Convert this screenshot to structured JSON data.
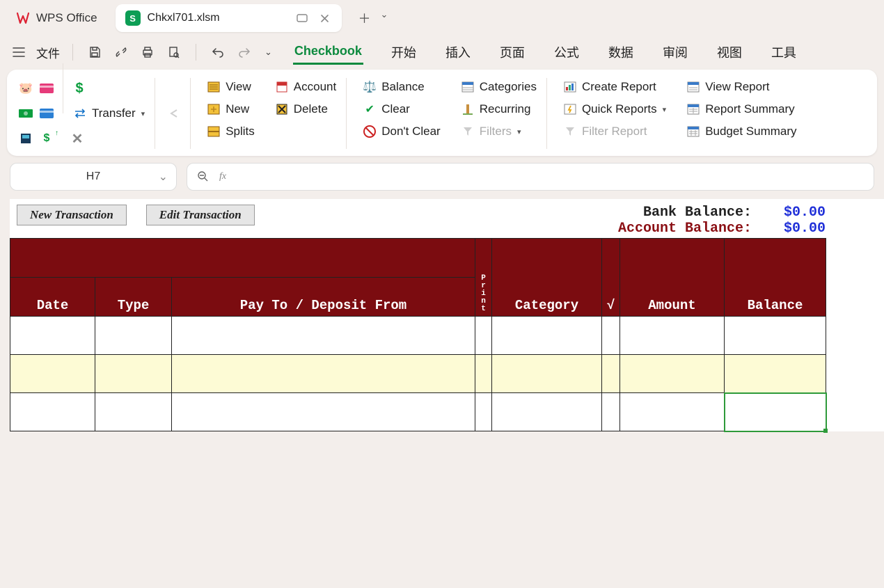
{
  "app": {
    "name": "WPS Office"
  },
  "tab": {
    "filename": "Chkxl701.xlsm",
    "badge": "S"
  },
  "menubar": {
    "file": "文件",
    "tabs": [
      "Checkbook",
      "开始",
      "插入",
      "页面",
      "公式",
      "数据",
      "审阅",
      "视图",
      "工具"
    ],
    "active": 0
  },
  "ribbon": {
    "transfer": "Transfer",
    "col2": {
      "view": "View",
      "new": "New",
      "splits": "Splits",
      "account": "Account",
      "delete": "Delete"
    },
    "col3": {
      "balance": "Balance",
      "clear": "Clear",
      "dontclear": "Don't Clear",
      "categories": "Categories",
      "recurring": "Recurring",
      "filters": "Filters"
    },
    "col4": {
      "create": "Create Report",
      "quick": "Quick Reports",
      "filterreport": "Filter Report",
      "view": "View Report",
      "summary": "Report Summary",
      "budget": "Budget Summary"
    }
  },
  "formula": {
    "cellref": "H7",
    "fx": "fx"
  },
  "sheet": {
    "btn_new": "New Transaction",
    "btn_edit": "Edit Transaction",
    "bank_label": "Bank Balance:",
    "acct_label": "Account Balance:",
    "bank_val": "$0.00",
    "acct_val": "$0.00",
    "headers": {
      "date": "Date",
      "type": "Type",
      "payto": "Pay To / Deposit From",
      "print": "Print",
      "category": "Category",
      "check": "√",
      "amount": "Amount",
      "balance": "Balance"
    }
  }
}
